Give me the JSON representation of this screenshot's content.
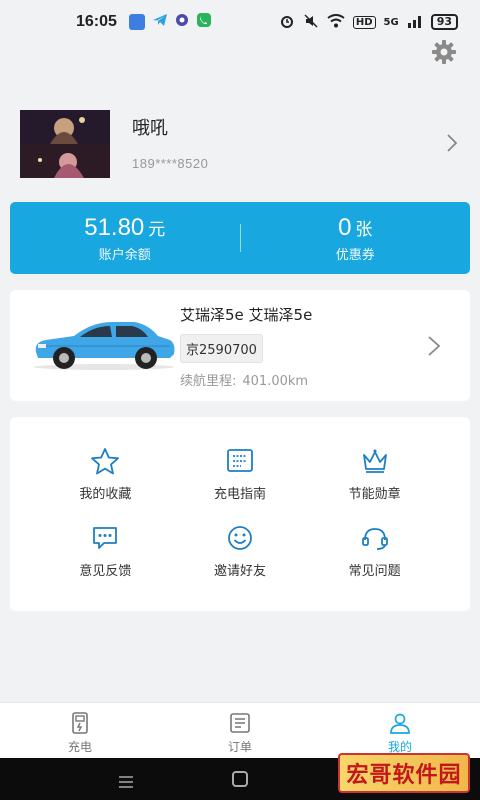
{
  "status_bar": {
    "time": "16:05",
    "network_label": "HD",
    "signal_label": "5G",
    "battery": "93"
  },
  "profile": {
    "nickname": "哦吼",
    "phone": "189****8520"
  },
  "balance": {
    "amount": "51.80",
    "amount_unit": "元",
    "amount_label": "账户余额",
    "coupons": "0",
    "coupons_unit": "张",
    "coupons_label": "优惠券"
  },
  "vehicle": {
    "name": "艾瑞泽5e 艾瑞泽5e",
    "plate": "京2590700",
    "range_label": "续航里程:",
    "range_value": "401.00km",
    "car_color": "#3fa6e8"
  },
  "menu": {
    "items": [
      {
        "label": "我的收藏",
        "icon": "star-icon"
      },
      {
        "label": "充电指南",
        "icon": "guide-icon"
      },
      {
        "label": "节能勋章",
        "icon": "crown-icon"
      },
      {
        "label": "意见反馈",
        "icon": "feedback-icon"
      },
      {
        "label": "邀请好友",
        "icon": "smile-icon"
      },
      {
        "label": "常见问题",
        "icon": "help-icon"
      }
    ]
  },
  "tabbar": {
    "tabs": [
      {
        "label": "充电",
        "icon": "charge-icon",
        "active": false
      },
      {
        "label": "订单",
        "icon": "order-icon",
        "active": false
      },
      {
        "label": "我的",
        "icon": "user-icon",
        "active": true
      }
    ]
  },
  "watermark": "宏哥软件园",
  "colors": {
    "accent": "#18a7df",
    "icon_blue": "#1d7fc2",
    "background": "#f1f2f4"
  }
}
